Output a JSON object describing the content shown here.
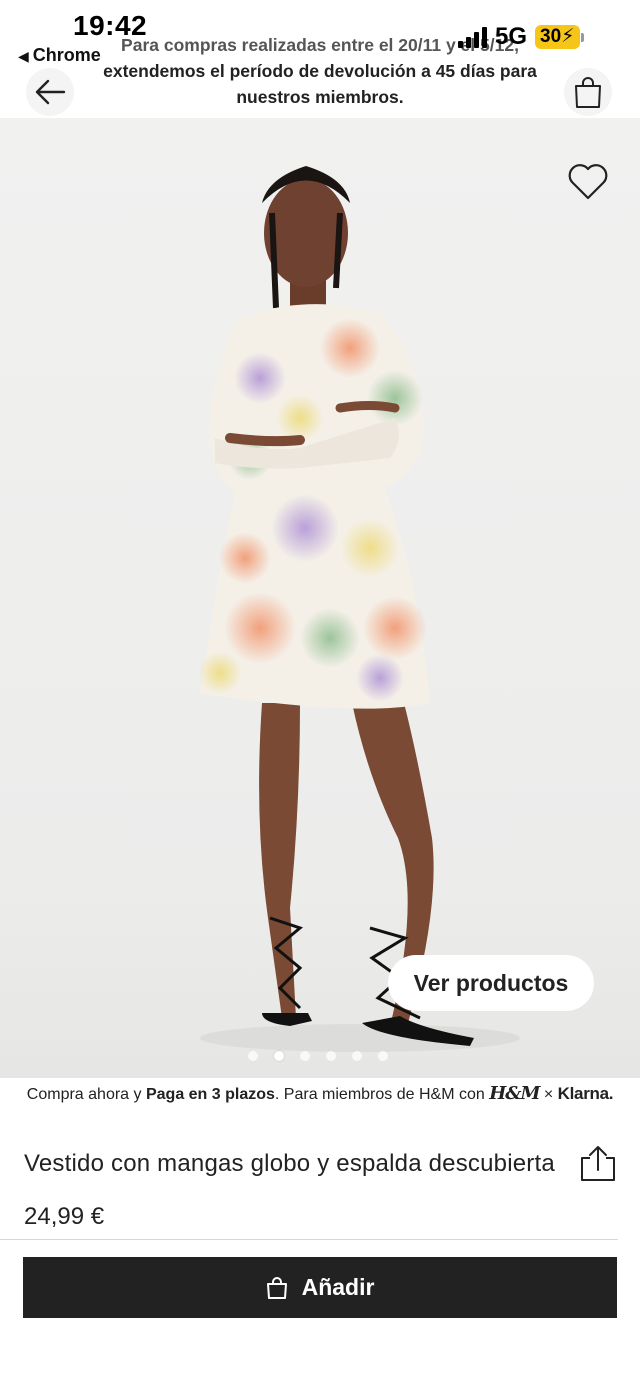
{
  "status_bar": {
    "time": "19:42",
    "back_app": "Chrome",
    "network": "5G",
    "battery": "30"
  },
  "header": {
    "promo_line1": "Para compras realizadas entre el 20/11 y el 5/12,",
    "promo_line2": "extendemos el período de devolución a 45 días para",
    "promo_line3": "nuestros miembros."
  },
  "hero": {
    "view_products_label": "Ver productos",
    "image_count": 6,
    "active_image_index": 1
  },
  "klarna": {
    "prefix": "Compra ahora y ",
    "bold": "Paga en 3 plazos",
    "middle": ". Para miembros de H&M con ",
    "hm_logo": "H&M",
    "times": "×",
    "klarna_logo": "Klarna."
  },
  "product": {
    "title": "Vestido con mangas globo y espalda descubierta",
    "price": "24,99 €",
    "add_label": "Añadir"
  },
  "colors": {
    "button_bg": "#222222",
    "image_bg": "#eeeeed"
  },
  "icons": {
    "back": "arrow-left-icon",
    "bag": "shopping-bag-icon",
    "heart": "heart-icon",
    "share": "share-icon"
  }
}
